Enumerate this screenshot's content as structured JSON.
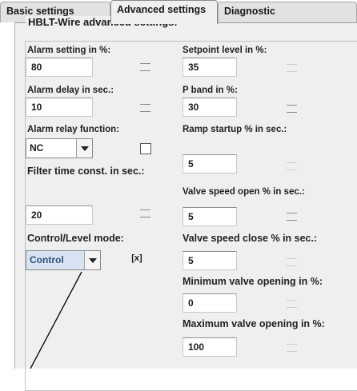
{
  "tabs": [
    {
      "label": "Basic settings"
    },
    {
      "label": "Advanced settings"
    },
    {
      "label": "Diagnostic"
    }
  ],
  "group_title": "HBLT-Wire advanced settings:",
  "left": {
    "alarm_setting": {
      "label": "Alarm setting in %:",
      "value": "80"
    },
    "alarm_delay": {
      "label": "Alarm delay in sec.:",
      "value": "10"
    },
    "alarm_relay": {
      "label": "Alarm relay function:",
      "value": "NC",
      "checked": false
    },
    "filter_time": {
      "label": "Filter time const. in sec.:",
      "value": "20"
    },
    "control_mode": {
      "label": "Control/Level mode:",
      "value": "Control",
      "checked": true
    }
  },
  "right": {
    "setpoint": {
      "label": "Setpoint level in %:",
      "value": "35"
    },
    "p_band": {
      "label": "P band in %:",
      "value": "30"
    },
    "ramp_startup": {
      "label": "Ramp startup % in sec.:",
      "value": "5"
    },
    "valve_open": {
      "label": "Valve speed open % in sec.:",
      "value": "5"
    },
    "valve_close": {
      "label": "Valve speed close % in sec.:",
      "value": "5"
    },
    "min_opening": {
      "label": "Minimum valve opening in %:",
      "value": "0"
    },
    "max_opening": {
      "label": "Maximum valve opening in %:",
      "value": "100"
    }
  },
  "check_mark": "[x]"
}
